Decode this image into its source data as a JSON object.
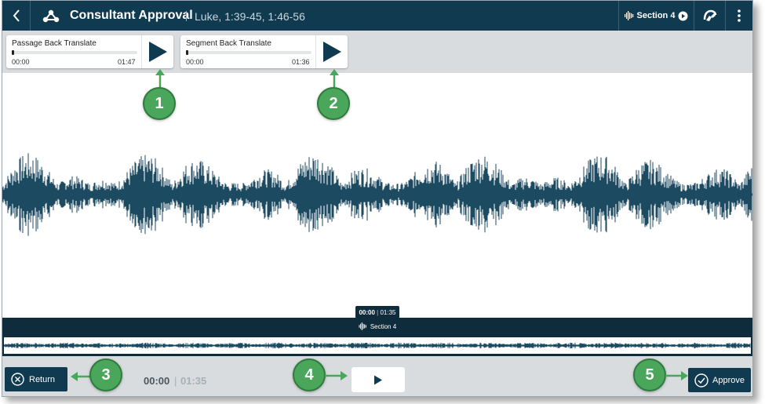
{
  "header": {
    "title": "Consultant Approval",
    "subtitle": "Luke, 1:39-45, 1:46-56",
    "section_label": "Section 4"
  },
  "players": [
    {
      "title": "Passage Back Translate",
      "start": "00:00",
      "end": "01:47"
    },
    {
      "title": "Segment Back Translate",
      "start": "00:00",
      "end": "01:36"
    }
  ],
  "waveform": {
    "tooltip_current": "00:00",
    "tooltip_total": "01:35",
    "section_label": "Section 4"
  },
  "bottom": {
    "return_label": "Return",
    "current_time": "00:00",
    "total_time": "01:35",
    "approve_label": "Approve"
  },
  "annotations": [
    "1",
    "2",
    "3",
    "4",
    "5"
  ],
  "colors": {
    "primary": "#0f3a50",
    "waveform": "#1c4a60",
    "callout": "#4aa65a"
  },
  "icons": {
    "back": "chevron-left-icon",
    "logo": "app-logo-icon",
    "waveform": "waveform-icon",
    "play": "play-icon",
    "tool": "headset-icon",
    "more": "kebab-menu-icon",
    "return": "close-circle-icon",
    "approve": "check-circle-icon"
  }
}
